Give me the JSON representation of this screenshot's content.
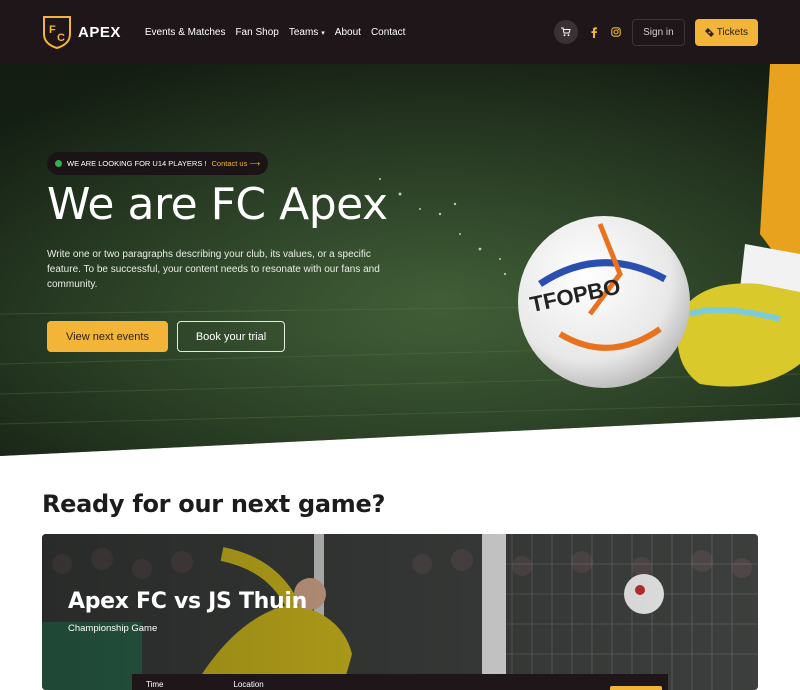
{
  "nav": {
    "brand_name": "APEX",
    "links": [
      {
        "label": "Events & Matches"
      },
      {
        "label": "Fan Shop"
      },
      {
        "label": "Teams"
      },
      {
        "label": "About"
      },
      {
        "label": "Contact"
      }
    ],
    "teams_caret": "▾",
    "signin_label": "Sign in",
    "tickets_label": "Tickets",
    "icons": [
      "cart-icon",
      "facebook-icon",
      "instagram-icon",
      "ticket-icon"
    ]
  },
  "hero": {
    "announcement": "WE ARE LOOKING FOR U14 PLAYERS !",
    "announcement_link": "Contact us ⟶",
    "title": "We are FC Apex",
    "text": "Write one or two paragraphs describing your club, its values, or a specific feature. To be successful, your content needs to resonate with our fans and community.",
    "primary_button": "View next events",
    "secondary_button": "Book your trial"
  },
  "next_game": {
    "heading": "Ready for our next game?",
    "title": "Apex FC vs JS Thuin",
    "subtitle": "Championship Game",
    "info_labels": [
      "Time",
      "Location"
    ]
  },
  "colors": {
    "navbar": "#1f1619",
    "accent": "#f2b538",
    "status_dot": "#2fb34a"
  }
}
